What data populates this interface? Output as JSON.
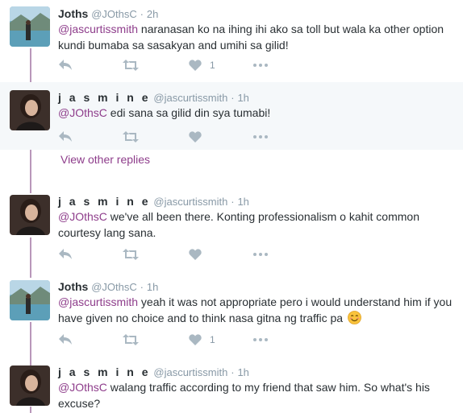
{
  "tweets": [
    {
      "fullname": "Joths",
      "handle": "@JOthsC",
      "sep": "·",
      "time": "2h",
      "mention": "@jascurtissmith",
      "text": "  naranasan ko na ihing ihi ako sa toll but wala ka other option kundi bumaba sa sasakyan and umihi sa gilid!",
      "likes": "1"
    },
    {
      "fullname": "j a s m i n e",
      "handle": "@jascurtissmith",
      "sep": "·",
      "time": "1h",
      "mention": "@JOthsC",
      "text": " edi sana sa gilid din sya tumabi!",
      "likes": ""
    },
    {
      "fullname": "j a s m i n e",
      "handle": "@jascurtissmith",
      "sep": "·",
      "time": "1h",
      "mention": "@JOthsC",
      "text": " we've all been there. Konting professionalism o kahit common courtesy lang sana.",
      "likes": ""
    },
    {
      "fullname": "Joths",
      "handle": "@JOthsC",
      "sep": "·",
      "time": "1h",
      "mention": "@jascurtissmith",
      "text": " yeah it was not appropriate pero i would understand him if you have given no choice and to think nasa gitna ng traffic pa ",
      "likes": "1"
    },
    {
      "fullname": "j a s m i n e",
      "handle": "@jascurtissmith",
      "sep": "·",
      "time": "1h",
      "mention": "@JOthsC",
      "text": " walang traffic according to my friend  that saw him. So what's his excuse?",
      "likes": ""
    }
  ],
  "view_other_replies": "View other replies",
  "colors": {
    "accent": "#8e3d8b",
    "thread_line": "#b997ba",
    "muted": "#8899a6",
    "icon": "#aab8c2",
    "highlight_bg": "#f5f8fa"
  },
  "icons": [
    "reply-icon",
    "retweet-icon",
    "like-icon",
    "more-icon",
    "smiling-face-emoji"
  ]
}
